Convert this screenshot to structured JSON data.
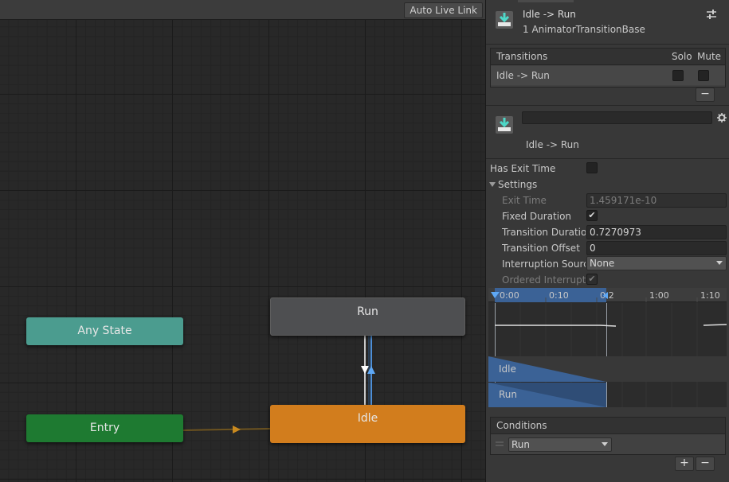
{
  "graph": {
    "toolbar": {
      "live_link_label": "Auto Live Link"
    },
    "nodes": {
      "any_state": "Any State",
      "entry": "Entry",
      "run": "Run",
      "idle": "Idle"
    },
    "colors": {
      "any_state": "#4b9c8f",
      "entry": "#1e7a31",
      "run": "#4e4f51",
      "idle": "#d27d1d",
      "selected_transition": "#4d8fd8"
    }
  },
  "inspector": {
    "header": {
      "title": "Idle -> Run",
      "subtitle": "1 AnimatorTransitionBase",
      "icon": "transition-icon"
    },
    "transitions_list": {
      "header": "Transitions",
      "col_solo": "Solo",
      "col_mute": "Mute",
      "rows": [
        {
          "label": "Idle -> Run",
          "solo": false,
          "mute": false
        }
      ],
      "remove_label": "−"
    },
    "transition": {
      "name_value": "",
      "label": "Idle -> Run"
    },
    "props": {
      "has_exit_time_label": "Has Exit Time",
      "has_exit_time": false,
      "settings_label": "Settings",
      "exit_time_label": "Exit Time",
      "exit_time_value": "1.459171e-10",
      "fixed_duration_label": "Fixed Duration",
      "fixed_duration_check": "✔",
      "transition_duration_label": "Transition Duration",
      "transition_duration_value": "0.7270973",
      "transition_offset_label": "Transition Offset",
      "transition_offset_value": "0",
      "interruption_source_label": "Interruption Source",
      "interruption_source_value": "None",
      "ordered_interruption_label": "Ordered Interruption",
      "ordered_interruption_check": "✔"
    },
    "timeline": {
      "ticks": [
        "0:00",
        "0:10",
        "0:20",
        "1:00",
        "1:10"
      ],
      "track_idle": "Idle",
      "track_run": "Run"
    },
    "conditions": {
      "header": "Conditions",
      "items": [
        {
          "parameter": "Run"
        }
      ],
      "add_label": "+",
      "remove_label": "−"
    }
  }
}
